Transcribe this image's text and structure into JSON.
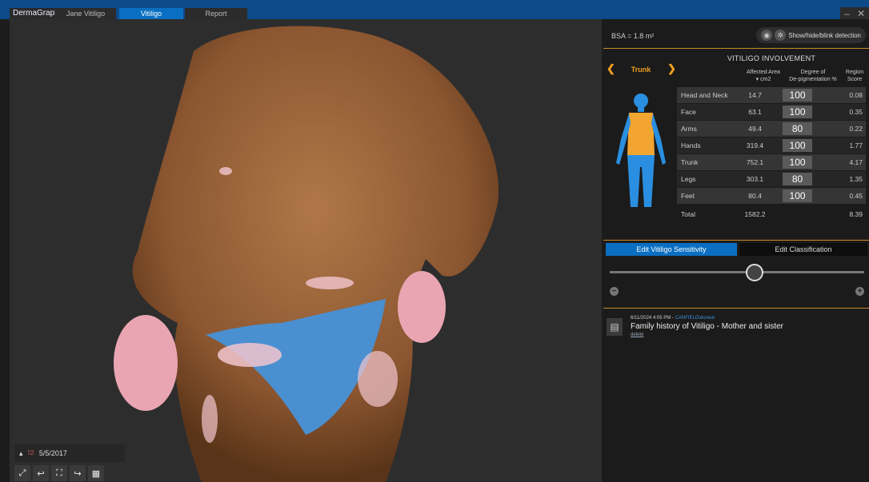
{
  "app": {
    "logo": "DermaGraphix"
  },
  "tabs": [
    {
      "label": "Jane Vitiligo",
      "active": false
    },
    {
      "label": "Vitiligo",
      "active": true
    },
    {
      "label": "Report",
      "active": false
    }
  ],
  "window_controls": {
    "minimize": "–",
    "close": "✕"
  },
  "panel": {
    "bsa_label": "BSA = 1.8 m²",
    "detection_label": "Show/hide/blink detection",
    "title": "VITILIGO INVOLVEMENT",
    "selected_region": "Trunk",
    "columns": {
      "area_line1": "Affected Area",
      "area_line2": "▾ cm2",
      "degree_line1": "Degree of",
      "degree_line2": "De-pigmentation %",
      "score_line1": "Region",
      "score_line2": "Score"
    },
    "rows": [
      {
        "region": "Head and Neck",
        "area": "14.7",
        "degree": "100",
        "score": "0.08"
      },
      {
        "region": "Face",
        "area": "63.1",
        "degree": "100",
        "score": "0.35"
      },
      {
        "region": "Arms",
        "area": "49.4",
        "degree": "80",
        "score": "0.22"
      },
      {
        "region": "Hands",
        "area": "319.4",
        "degree": "100",
        "score": "1.77"
      },
      {
        "region": "Trunk",
        "area": "752.1",
        "degree": "100",
        "score": "4.17"
      },
      {
        "region": "Legs",
        "area": "303.1",
        "degree": "80",
        "score": "1.35"
      },
      {
        "region": "Feet",
        "area": "80.4",
        "degree": "100",
        "score": "0.45"
      }
    ],
    "total": {
      "label": "Total",
      "area": "1582.2",
      "score": "8.39"
    },
    "buttons": {
      "sensitivity": "Edit Vitiligo Sensitivity",
      "classification": "Edit Classification"
    },
    "slider": {
      "value_fraction": 0.57
    },
    "note": {
      "timestamp": "6/11/2024 4:05 PM - ",
      "user": "CANFIELD\\doneal",
      "text": "Family history of Vitiligo - Mother and sister",
      "delete": "delete"
    }
  },
  "viewport": {
    "date": "5/5/2017"
  },
  "colors": {
    "accent": "#0a6fc2",
    "highlight": "#f0a020",
    "figure_body": "#2a8fe0",
    "figure_trunk": "#f2a531"
  }
}
